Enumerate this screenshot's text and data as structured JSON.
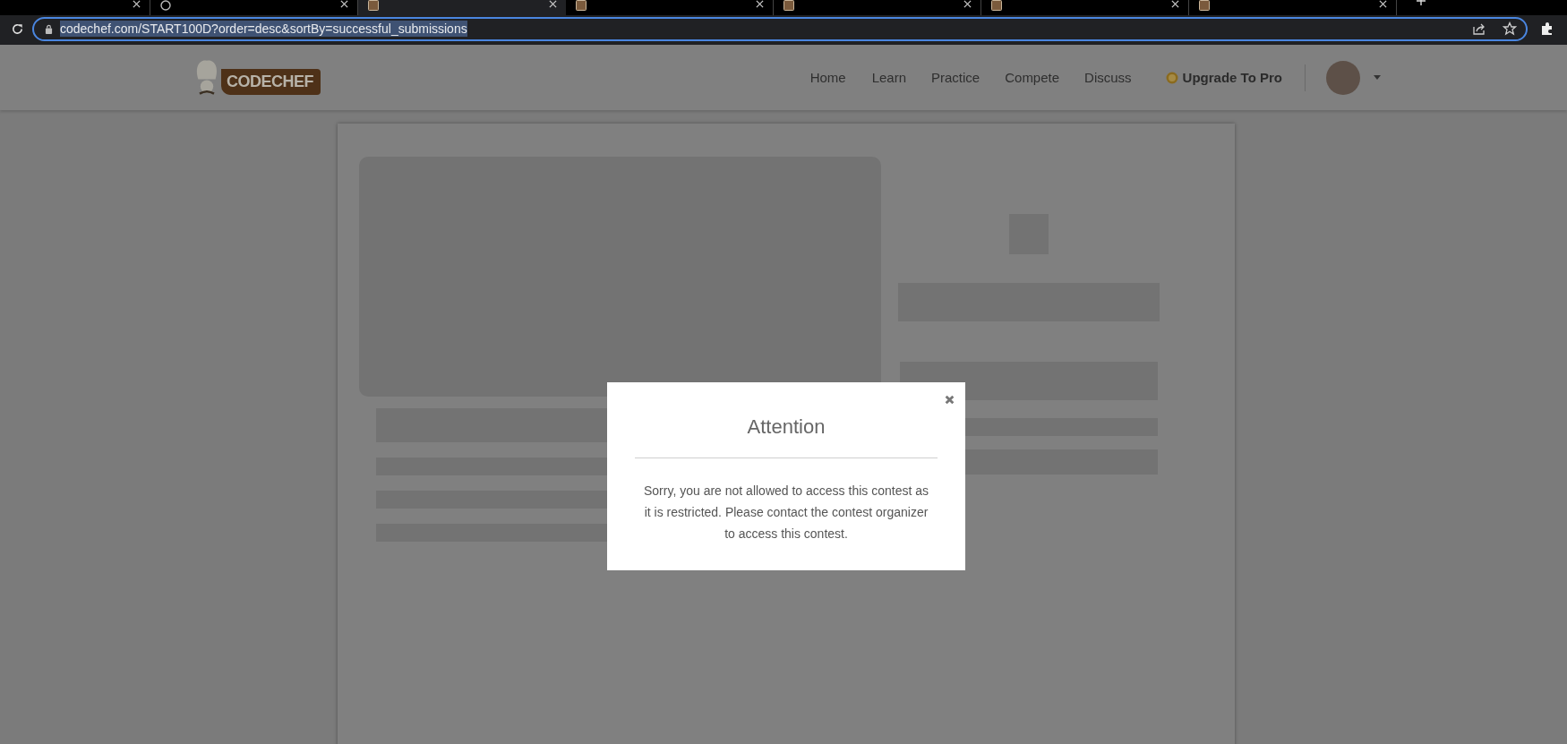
{
  "browser": {
    "tabs": [
      {
        "kind": "none",
        "selected": false
      },
      {
        "kind": "globe",
        "selected": false
      },
      {
        "kind": "site",
        "selected": true
      },
      {
        "kind": "site",
        "selected": false
      },
      {
        "kind": "site",
        "selected": false
      },
      {
        "kind": "site",
        "selected": false
      },
      {
        "kind": "site",
        "selected": false
      }
    ],
    "address": {
      "url": "codechef.com/START100D?order=desc&sortBy=successful_submissions",
      "selected": true
    }
  },
  "header": {
    "logo": "CODECHEF",
    "nav": [
      "Home",
      "Learn",
      "Practice",
      "Compete",
      "Discuss"
    ],
    "upgrade": "Upgrade To Pro"
  },
  "modal": {
    "title": "Attention",
    "message": "Sorry, you are not allowed to access this contest as it is restricted. Please contact the contest organizer to access this contest."
  }
}
